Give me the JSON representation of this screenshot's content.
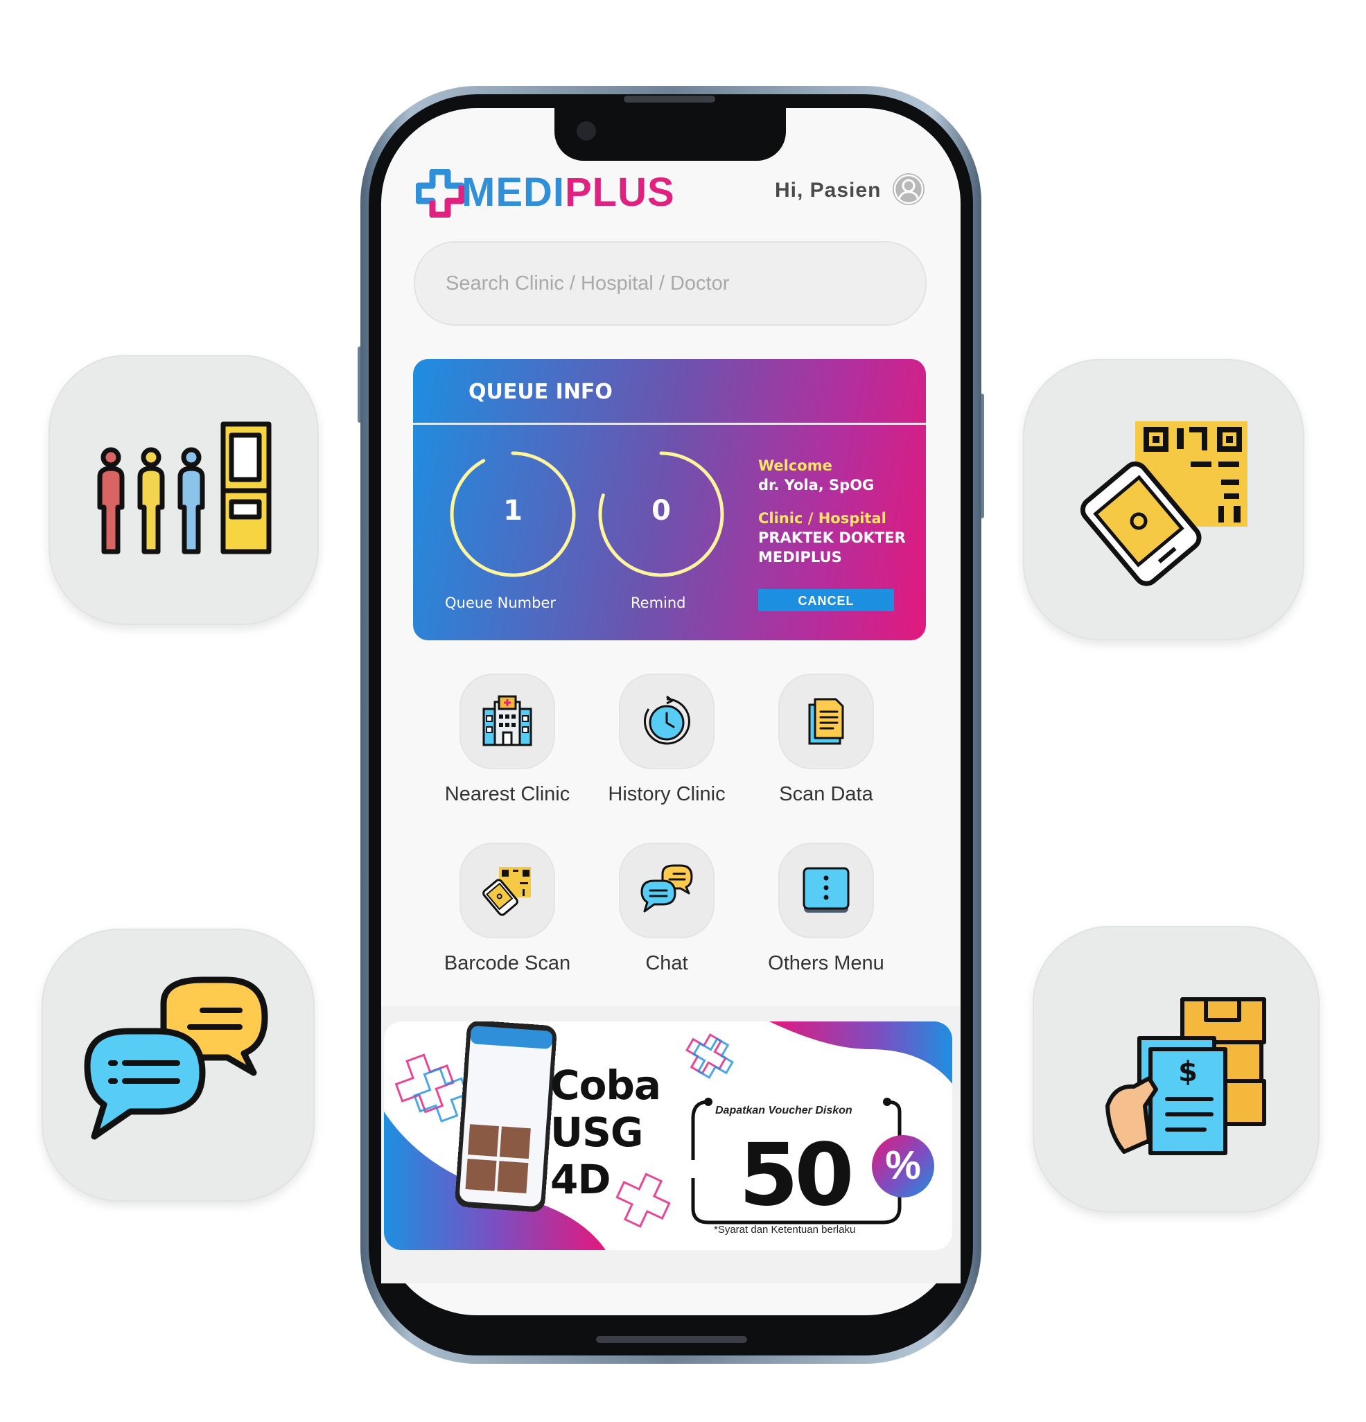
{
  "app": {
    "logo_part1": "MEDI",
    "logo_part2": "PLUS",
    "greeting": "Hi, Pasien"
  },
  "search": {
    "placeholder": "Search Clinic / Hospital / Doctor"
  },
  "queue": {
    "title": "QUEUE INFO",
    "queue_number": "1",
    "queue_number_label": "Queue Number",
    "queue_progress": 0.92,
    "remind": "0",
    "remind_label": "Remind",
    "remind_progress": 0.8,
    "welcome_label": "Welcome",
    "doctor_name": "dr. Yola, SpOG",
    "clinic_label": "Clinic / Hospital",
    "clinic_name_line1": "PRAKTEK DOKTER",
    "clinic_name_line2": "MEDIPLUS",
    "cancel_label": "CANCEL"
  },
  "menu": [
    {
      "label": "Nearest Clinic",
      "icon": "hospital-icon"
    },
    {
      "label": "History Clinic",
      "icon": "history-clock-icon"
    },
    {
      "label": "Scan Data",
      "icon": "document-icon"
    },
    {
      "label": "Barcode Scan",
      "icon": "barcode-scan-icon"
    },
    {
      "label": "Chat",
      "icon": "chat-icon"
    },
    {
      "label": "Others Menu",
      "icon": "more-menu-icon"
    }
  ],
  "promo": {
    "line1": "Coba",
    "line2": "USG",
    "line3": "4D",
    "voucher_title": "Dapatkan Voucher Diskon",
    "discount_value": "50",
    "discount_unit": "%",
    "terms": "*Syarat dan Ketentuan berlaku"
  },
  "feature_tiles": [
    {
      "icon": "queue-icon"
    },
    {
      "icon": "qr-scan-icon"
    },
    {
      "icon": "chat-bubbles-icon"
    },
    {
      "icon": "payment-receipt-icon"
    }
  ],
  "colors": {
    "brand_blue": "#2f8fd8",
    "brand_pink": "#e0217f",
    "ring_yellow": "#fff59d",
    "cancel_blue": "#1d8fe0"
  }
}
